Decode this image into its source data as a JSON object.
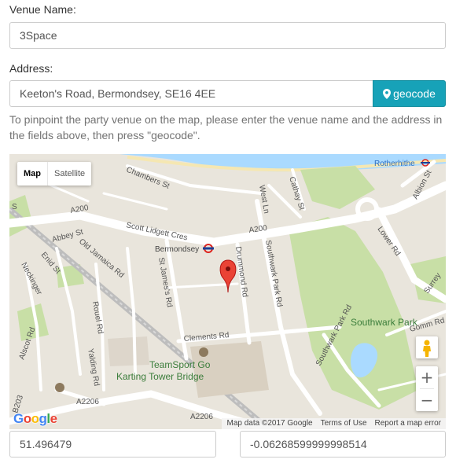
{
  "form": {
    "venue_label": "Venue Name:",
    "venue_value": "3Space",
    "address_label": "Address:",
    "address_value": "Keeton's Road, Bermondsey, SE16 4EE",
    "geocode_label": "geocode",
    "help_text": "To pinpoint the party venue on the map, please enter the venue name and the address in the fields above, then press \"geocode\".",
    "latitude": "51.496479",
    "longitude": "-0.06268599999998514"
  },
  "map": {
    "type_map": "Map",
    "type_satellite": "Satellite",
    "zoom_in": "+",
    "zoom_out": "−",
    "attribution": {
      "data": "Map data ©2017 Google",
      "terms": "Terms of Use",
      "report": "Report a map error"
    },
    "logo": "Google",
    "labels": {
      "chambers": "Chambers St",
      "rotherhithe": "Rotherhithe",
      "albion": "Albion St",
      "cathay": "Cathay St",
      "westln": "West Ln",
      "southwark_park_rd": "Southwark Park Rd",
      "a200_left": "A200",
      "a200_mid": "A200",
      "scott": "Scott Lidgett Cres",
      "abbey": "Abbey St",
      "bermondsey": "Bermondsey",
      "enid": "Enid St",
      "old_jamaica": "Old Jamaica Rd",
      "st_james": "St James's Rd",
      "drummond": "Drummond Rd",
      "lower_rd": "Lower Rd",
      "surrey": "Surrey",
      "neckinger": "Neckinger",
      "rouel": "Rouel Rd",
      "yalding": "Yalding Rd",
      "alscot": "Alscot Rd",
      "clements": "Clements Rd",
      "southwark_park": "Southwark Park",
      "park_rd2": "Southwark Park Rd",
      "gomm": "Gomm Rd",
      "teamsport1": "TeamSport Go",
      "teamsport2": "Karting Tower Bridge",
      "a2206_a": "A2206",
      "a2206_b": "A2206",
      "b203": "B203",
      "s_edge": "S"
    }
  },
  "colors": {
    "accent": "#17a2b8",
    "park": "#c8dfa6",
    "water": "#aadaff",
    "road": "#ffffff",
    "map_bg": "#e9e5dc",
    "marker": "#ea4335"
  }
}
